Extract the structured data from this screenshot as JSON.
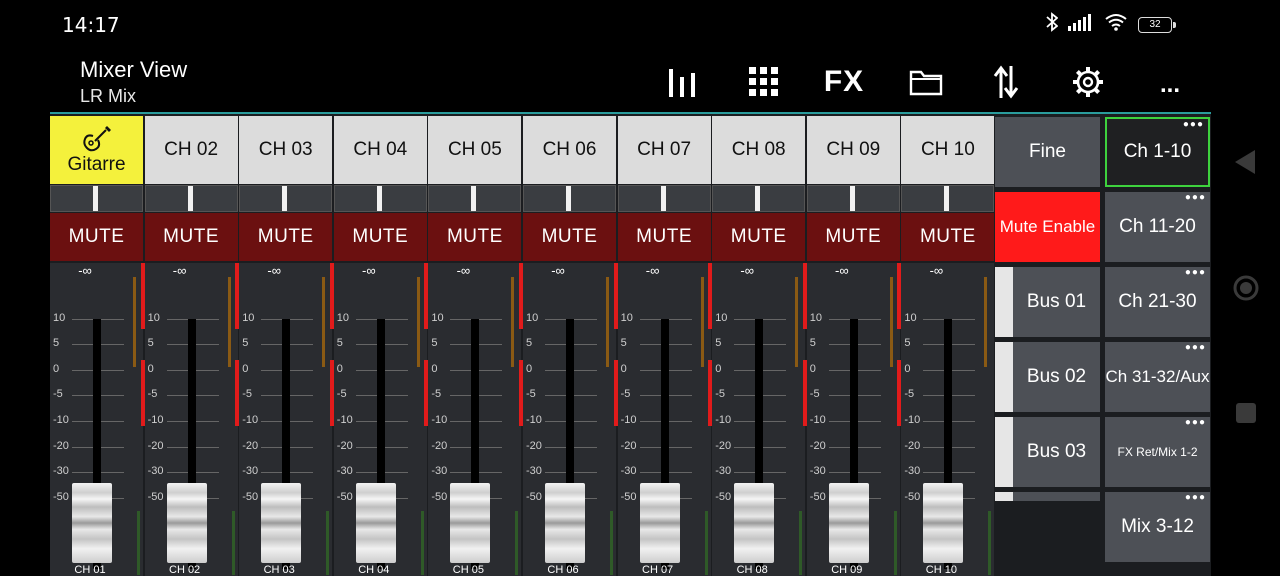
{
  "status": {
    "time": "14:17",
    "battery": "32"
  },
  "header": {
    "title": "Mixer View",
    "subtitle": "LR Mix",
    "fx_label": "FX",
    "more_label": "..."
  },
  "channels": [
    {
      "head": "Gitarre",
      "mute": "MUTE",
      "inf": "-∞",
      "foot": "CH 01",
      "pan": 0.5,
      "active": true,
      "fader": 0.38
    },
    {
      "head": "CH 02",
      "mute": "MUTE",
      "inf": "-∞",
      "foot": "CH 02",
      "pan": 0.5,
      "fader": 0.38
    },
    {
      "head": "CH 03",
      "mute": "MUTE",
      "inf": "-∞",
      "foot": "CH 03",
      "pan": 0.5,
      "fader": 0.38
    },
    {
      "head": "CH 04",
      "mute": "MUTE",
      "inf": "-∞",
      "foot": "CH 04",
      "pan": 0.5,
      "fader": 0.38
    },
    {
      "head": "CH 05",
      "mute": "MUTE",
      "inf": "-∞",
      "foot": "CH 05",
      "pan": 0.5,
      "fader": 0.38
    },
    {
      "head": "CH 06",
      "mute": "MUTE",
      "inf": "-∞",
      "foot": "CH 06",
      "pan": 0.5,
      "fader": 0.38
    },
    {
      "head": "CH 07",
      "mute": "MUTE",
      "inf": "-∞",
      "foot": "CH 07",
      "pan": 0.5,
      "fader": 0.38
    },
    {
      "head": "CH 08",
      "mute": "MUTE",
      "inf": "-∞",
      "foot": "CH 08",
      "pan": 0.5,
      "fader": 0.38
    },
    {
      "head": "CH 09",
      "mute": "MUTE",
      "inf": "-∞",
      "foot": "CH 09",
      "pan": 0.5,
      "fader": 0.38
    },
    {
      "head": "CH 10",
      "mute": "MUTE",
      "inf": "-∞",
      "foot": "CH 10",
      "pan": 0.5,
      "fader": 0.38
    }
  ],
  "fader_scale": [
    "10",
    "5",
    "0",
    "-5",
    "-10",
    "-20",
    "-30",
    "-50"
  ],
  "side": {
    "fine": "Fine",
    "mute_enable": "Mute Enable",
    "buses": [
      "Bus 01",
      "Bus 02",
      "Bus 03"
    ]
  },
  "banks": [
    {
      "label": "Ch 1-10",
      "selected": true
    },
    {
      "label": "Ch 11-20"
    },
    {
      "label": "Ch 21-30"
    },
    {
      "label": "Ch 31-32/Aux"
    },
    {
      "label": "FX Ret/Mix 1-2"
    },
    {
      "label": "Mix 3-12"
    }
  ],
  "bank_dots": "●●●",
  "colors": {
    "selected_channel": "#f4f13c",
    "mute": "#6b1010",
    "mute_enable": "#ff1a1a",
    "bank_selected_border": "#3ed23e",
    "header_accent": "#2a9c9c"
  }
}
